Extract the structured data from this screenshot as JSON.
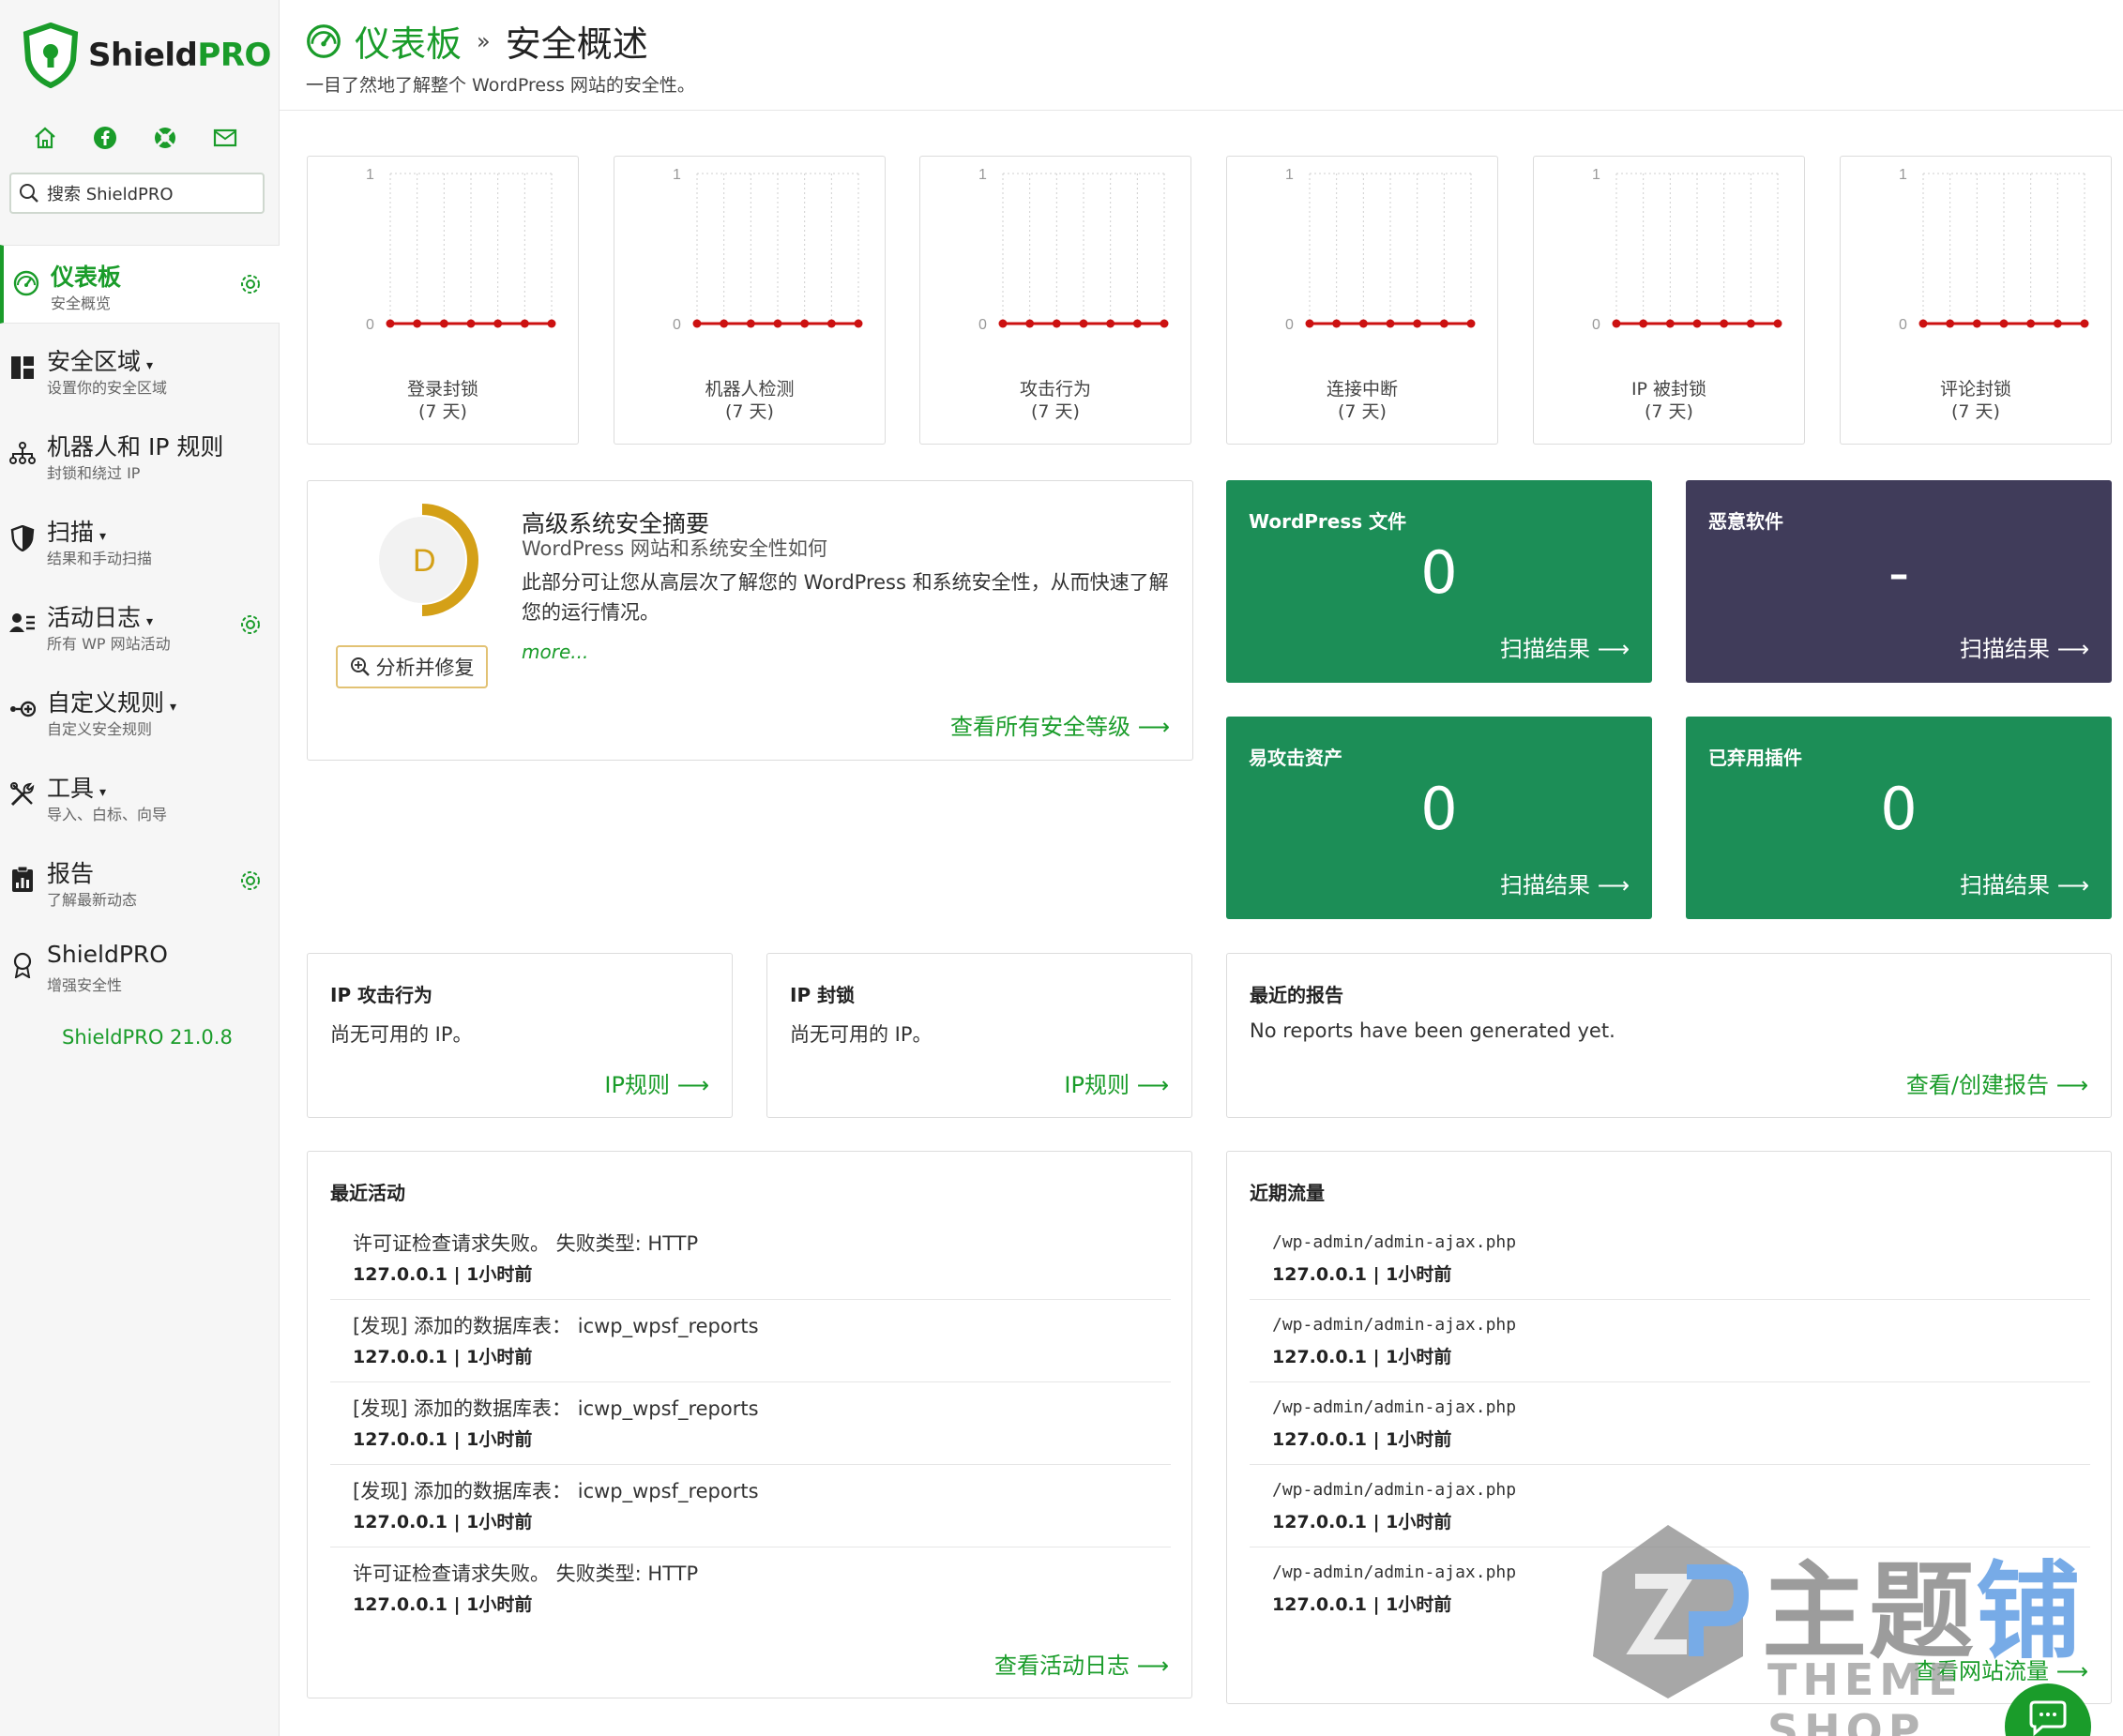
{
  "brand": {
    "name_main": "Shield",
    "name_accent": "PRO"
  },
  "sidebar": {
    "search_placeholder": "搜索 ShieldPRO",
    "items": [
      {
        "title": "仪表板",
        "sub": "安全概览",
        "icon": "dashboard-icon",
        "active": true,
        "gear": true,
        "caret": false
      },
      {
        "title": "安全区域",
        "sub": "设置你的安全区域",
        "icon": "zones-icon",
        "active": false,
        "gear": false,
        "caret": true
      },
      {
        "title": "机器人和 IP 规则",
        "sub": "封锁和绕过 IP",
        "icon": "network-icon",
        "active": false,
        "gear": false,
        "caret": false
      },
      {
        "title": "扫描",
        "sub": "结果和手动扫描",
        "icon": "shield-icon",
        "active": false,
        "gear": false,
        "caret": true
      },
      {
        "title": "活动日志",
        "sub": "所有 WP 网站活动",
        "icon": "activity-icon",
        "active": false,
        "gear": true,
        "caret": true
      },
      {
        "title": "自定义规则",
        "sub": "自定义安全规则",
        "icon": "rules-icon",
        "active": false,
        "gear": false,
        "caret": true
      },
      {
        "title": "工具",
        "sub": "导入、白标、向导",
        "icon": "tools-icon",
        "active": false,
        "gear": false,
        "caret": true
      },
      {
        "title": "报告",
        "sub": "了解最新动态",
        "icon": "reports-icon",
        "active": false,
        "gear": true,
        "caret": false
      },
      {
        "title": "ShieldPRO",
        "sub": "增强安全性",
        "icon": "award-icon",
        "active": false,
        "gear": false,
        "caret": false
      }
    ],
    "caret_glyph": "▾",
    "version": "ShieldPRO 21.0.8"
  },
  "header": {
    "crumb_home": "仪表板",
    "crumb_sep": "»",
    "crumb_current": "安全概述",
    "subtitle": "一目了然地了解整个 WordPress 网站的安全性。"
  },
  "stats": [
    {
      "label": "登录封锁",
      "period": "(7 天)"
    },
    {
      "label": "机器人检测",
      "period": "(7 天)"
    },
    {
      "label": "攻击行为",
      "period": "(7 天)"
    },
    {
      "label": "连接中断",
      "period": "(7 天)"
    },
    {
      "label": "IP 被封锁",
      "period": "(7 天)"
    },
    {
      "label": "评论封锁",
      "period": "(7 天)"
    }
  ],
  "chart_data": [
    {
      "type": "line",
      "title": "登录封锁 (7 天)",
      "x": [
        1,
        2,
        3,
        4,
        5,
        6,
        7
      ],
      "values": [
        0,
        0,
        0,
        0,
        0,
        0,
        0
      ],
      "ylim": [
        0,
        1
      ],
      "yticks": [
        "0",
        "1"
      ],
      "grid": true
    },
    {
      "type": "line",
      "title": "机器人检测 (7 天)",
      "x": [
        1,
        2,
        3,
        4,
        5,
        6,
        7
      ],
      "values": [
        0,
        0,
        0,
        0,
        0,
        0,
        0
      ],
      "ylim": [
        0,
        1
      ],
      "yticks": [
        "0",
        "1"
      ],
      "grid": true
    },
    {
      "type": "line",
      "title": "攻击行为 (7 天)",
      "x": [
        1,
        2,
        3,
        4,
        5,
        6,
        7
      ],
      "values": [
        0,
        0,
        0,
        0,
        0,
        0,
        0
      ],
      "ylim": [
        0,
        1
      ],
      "yticks": [
        "0",
        "1"
      ],
      "grid": true
    },
    {
      "type": "line",
      "title": "连接中断 (7 天)",
      "x": [
        1,
        2,
        3,
        4,
        5,
        6,
        7
      ],
      "values": [
        0,
        0,
        0,
        0,
        0,
        0,
        0
      ],
      "ylim": [
        0,
        1
      ],
      "yticks": [
        "0",
        "1"
      ],
      "grid": true
    },
    {
      "type": "line",
      "title": "IP 被封锁 (7 天)",
      "x": [
        1,
        2,
        3,
        4,
        5,
        6,
        7
      ],
      "values": [
        0,
        0,
        0,
        0,
        0,
        0,
        0
      ],
      "ylim": [
        0,
        1
      ],
      "yticks": [
        "0",
        "1"
      ],
      "grid": true
    },
    {
      "type": "line",
      "title": "评论封锁 (7 天)",
      "x": [
        1,
        2,
        3,
        4,
        5,
        6,
        7
      ],
      "values": [
        0,
        0,
        0,
        0,
        0,
        0,
        0
      ],
      "ylim": [
        0,
        1
      ],
      "yticks": [
        "0",
        "1"
      ],
      "grid": true
    }
  ],
  "summary": {
    "grade": "D",
    "grade_fraction": 0.5,
    "button": "分析并修复",
    "title": "高级系统安全摘要",
    "subtitle": "WordPress 网站和系统安全性如何",
    "desc": "此部分可让您从高层次了解您的 WordPress 和系统安全性，从而快速了解您的运行情况。",
    "more": "more...",
    "link": "查看所有安全等级 ⟶"
  },
  "tiles": [
    {
      "title": "WordPress 文件",
      "value": "0",
      "link": "扫描结果 ⟶",
      "style": "green"
    },
    {
      "title": "恶意软件",
      "value": "-",
      "link": "扫描结果 ⟶",
      "style": "dark"
    },
    {
      "title": "易攻击资产",
      "value": "0",
      "link": "扫描结果 ⟶",
      "style": "green"
    },
    {
      "title": "已弃用插件",
      "value": "0",
      "link": "扫描结果 ⟶",
      "style": "green"
    }
  ],
  "ip_attacks": {
    "title": "IP 攻击行为",
    "text": "尚无可用的 IP。",
    "link": "IP规则 ⟶"
  },
  "ip_blocks": {
    "title": "IP 封锁",
    "text": "尚无可用的 IP。",
    "link": "IP规则 ⟶"
  },
  "reports": {
    "title": "最近的报告",
    "text": "No reports have been generated yet.",
    "link": "查看/创建报告 ⟶"
  },
  "activity": {
    "title": "最近活动",
    "rows": [
      {
        "text": "许可证检查请求失败。 失败类型: HTTP",
        "meta": "127.0.0.1 | 1小时前"
      },
      {
        "text": "[发现] 添加的数据库表： icwp_wpsf_reports",
        "meta": "127.0.0.1 | 1小时前"
      },
      {
        "text": "[发现] 添加的数据库表： icwp_wpsf_reports",
        "meta": "127.0.0.1 | 1小时前"
      },
      {
        "text": "[发现] 添加的数据库表： icwp_wpsf_reports",
        "meta": "127.0.0.1 | 1小时前"
      },
      {
        "text": "许可证检查请求失败。 失败类型: HTTP",
        "meta": "127.0.0.1 | 1小时前"
      }
    ],
    "link": "查看活动日志 ⟶"
  },
  "traffic": {
    "title": "近期流量",
    "rows": [
      {
        "text": "/wp-admin/admin-ajax.php",
        "meta": "127.0.0.1 | 1小时前"
      },
      {
        "text": "/wp-admin/admin-ajax.php",
        "meta": "127.0.0.1 | 1小时前"
      },
      {
        "text": "/wp-admin/admin-ajax.php",
        "meta": "127.0.0.1 | 1小时前"
      },
      {
        "text": "/wp-admin/admin-ajax.php",
        "meta": "127.0.0.1 | 1小时前"
      },
      {
        "text": "/wp-admin/admin-ajax.php",
        "meta": "127.0.0.1 | 1小时前"
      }
    ],
    "link": "查看网站流量 ⟶"
  },
  "watermark": {
    "text_gray": "主题",
    "text_blue": "铺",
    "sub": "THEME SHOP"
  },
  "colors": {
    "accent": "#1a9c2a",
    "tile_green": "#1c8e57",
    "tile_dark": "#403c5a",
    "grade": "#d4a017",
    "chart_line": "#cc1111"
  }
}
